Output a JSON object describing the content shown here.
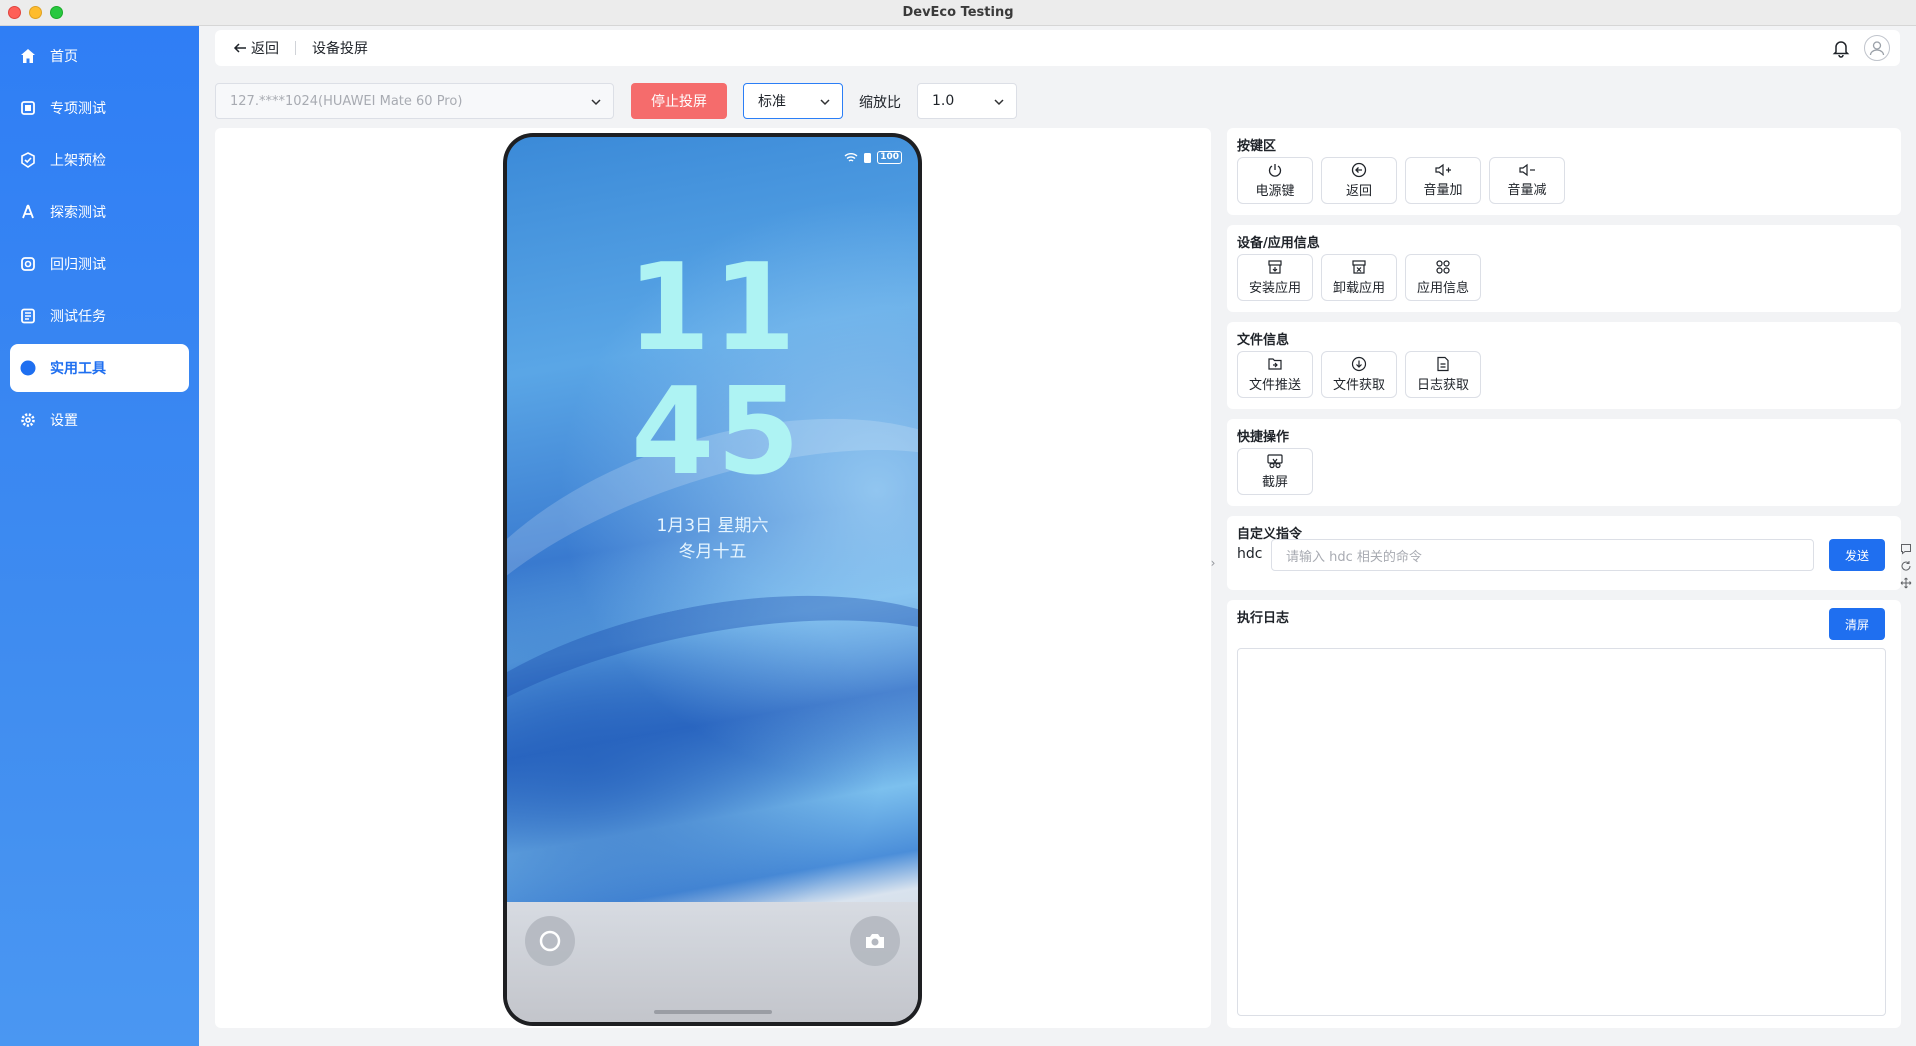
{
  "window": {
    "title": "DevEco Testing"
  },
  "sidebar": {
    "items": [
      {
        "label": "首页",
        "icon": "home-icon"
      },
      {
        "label": "专项测试",
        "icon": "special-test-icon"
      },
      {
        "label": "上架预检",
        "icon": "shield-check-icon"
      },
      {
        "label": "探索测试",
        "icon": "explore-icon"
      },
      {
        "label": "回归测试",
        "icon": "regression-icon"
      },
      {
        "label": "测试任务",
        "icon": "task-list-icon"
      },
      {
        "label": "实用工具",
        "icon": "wrench-icon",
        "active": true
      },
      {
        "label": "设置",
        "icon": "gear-icon"
      }
    ]
  },
  "header": {
    "back_label": "返回",
    "page_title": "设备投屏"
  },
  "toolbar": {
    "device": "127.****1024(HUAWEI Mate 60 Pro)",
    "stop_label": "停止投屏",
    "mode": "标准",
    "zoom_label": "缩放比",
    "zoom_value": "1.0"
  },
  "phone": {
    "battery": "100",
    "hour": "11",
    "minute": "45",
    "date": "1月3日  星期六",
    "lunar": "冬月十五"
  },
  "panels": {
    "keys": {
      "title": "按键区",
      "buttons": [
        "电源键",
        "返回",
        "音量加",
        "音量减"
      ]
    },
    "device_info": {
      "title": "设备/应用信息",
      "buttons": [
        "安装应用",
        "卸载应用",
        "应用信息"
      ]
    },
    "file_info": {
      "title": "文件信息",
      "buttons": [
        "文件推送",
        "文件获取",
        "日志获取"
      ]
    },
    "quick": {
      "title": "快捷操作",
      "buttons": [
        "截屏"
      ]
    },
    "custom": {
      "title": "自定义指令",
      "prefix": "hdc",
      "placeholder": "请输入 hdc 相关的命令",
      "send_label": "发送"
    },
    "log": {
      "title": "执行日志",
      "clear_label": "清屏"
    }
  },
  "colors": {
    "accent": "#1f6ff0",
    "danger": "#f56c6c",
    "sidebar": "#2f7ef5"
  }
}
